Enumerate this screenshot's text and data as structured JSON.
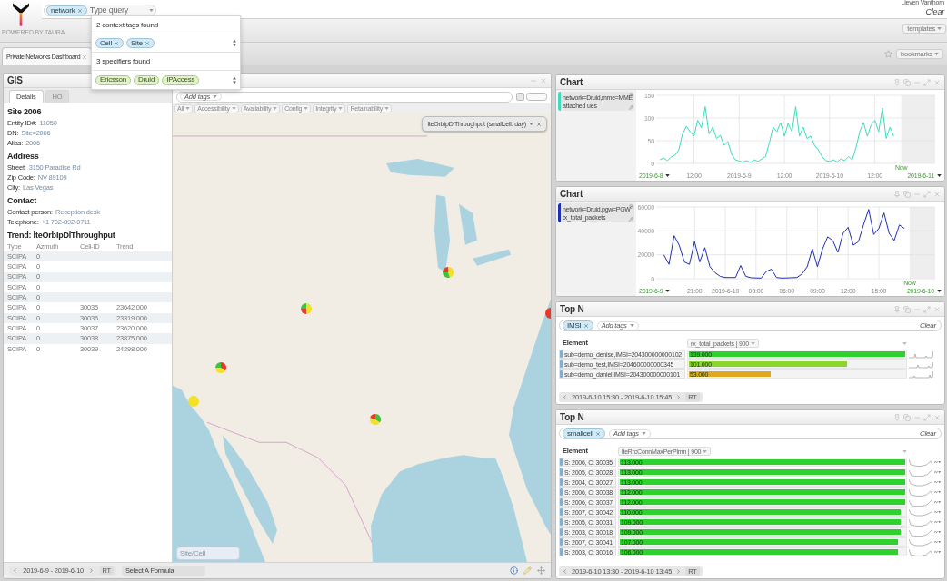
{
  "top_bar": {
    "logo_caption": "POWERED BY TAURA",
    "query_tags": [
      "network"
    ],
    "query_placeholder": "Type query",
    "user": "Lieven Vanthorn",
    "clear": "Clear",
    "templates": "templates"
  },
  "suggestions": [
    {
      "kind": "context",
      "title": "2 context tags found",
      "tags": [
        "Cell",
        "Site"
      ]
    },
    {
      "kind": "specifier",
      "title": "3 specifiers found",
      "tags": [
        "Ericsson",
        "Druid",
        "IPAccess"
      ]
    }
  ],
  "tabs": [
    {
      "label": "Private Networks Dashboard",
      "selected": true
    }
  ],
  "bookmarks": "bookmarks",
  "gis": {
    "title": "GIS",
    "detail_tabs": [
      {
        "label": "Details",
        "selected": true
      },
      {
        "label": "HO",
        "selected": false
      }
    ],
    "sections": [
      {
        "heading": "Site 2006",
        "fields": [
          {
            "label": "Entity ID#:",
            "value": "11050"
          },
          {
            "label": "DN:",
            "value": "Site=2006"
          },
          {
            "label": "Alias:",
            "value": "2006"
          }
        ]
      },
      {
        "heading": "Address",
        "fields": [
          {
            "label": "Street:",
            "value": "3150 Paradise Rd"
          },
          {
            "label": "Zip Code:",
            "value": "NV 89109"
          },
          {
            "label": "City:",
            "value": "Las Vegas"
          }
        ]
      },
      {
        "heading": "Contact",
        "fields": [
          {
            "label": "Contact person:",
            "value": "Reception desk"
          },
          {
            "label": "Telephone:",
            "value": "+1 702-892-0711"
          }
        ]
      }
    ],
    "trend": {
      "heading": "Trend: lteOrbIpDlThroughput",
      "columns": [
        "Type",
        "Azmuth",
        "Cell-ID",
        "Trend"
      ],
      "rows": [
        {
          "type": "SCIPA",
          "azimuth": "0"
        },
        {
          "type": "SCIPA",
          "azimuth": "0"
        },
        {
          "type": "SCIPA",
          "azimuth": "0"
        },
        {
          "type": "SCIPA",
          "azimuth": "0"
        },
        {
          "type": "SCIPA",
          "azimuth": "0"
        },
        {
          "type": "SCIPA",
          "azimuth": "0",
          "cell_id": "30035",
          "trend": "23642.000"
        },
        {
          "type": "SCIPA",
          "azimuth": "0",
          "cell_id": "30036",
          "trend": "23319.000"
        },
        {
          "type": "SCIPA",
          "azimuth": "0",
          "cell_id": "30037",
          "trend": "23620.000"
        },
        {
          "type": "SCIPA",
          "azimuth": "0",
          "cell_id": "30038",
          "trend": "23875.000"
        },
        {
          "type": "SCIPA",
          "azimuth": "0",
          "cell_id": "30039",
          "trend": "24298.000"
        }
      ]
    },
    "map": {
      "tag_placeholder": "Add tags",
      "categories": [
        "All",
        "Accessibility",
        "Availability",
        "Config",
        "Integrity",
        "Retainability"
      ],
      "layer": "lteOrbIpDlThroughput (smallcell: day)",
      "search_placeholder": "Site/Cell"
    },
    "footer": {
      "range": "2019-6-9 - 2019-6-10",
      "rt": "RT",
      "formula": "Select A Formula"
    }
  },
  "charts": [
    {
      "title": "Chart",
      "legend_scope": "network=Druid,mme=MME",
      "range_start": "2019-6-8",
      "range_end": "2019-6-11",
      "now_label": "Now",
      "chart_data": {
        "type": "line",
        "grid": true,
        "categories": [
          null,
          null,
          null,
          null,
          null,
          null,
          null,
          null,
          null,
          "12:00",
          null,
          null,
          null,
          null,
          null,
          null,
          null,
          null,
          null,
          null,
          null,
          "2019-6-9",
          null,
          null,
          null,
          null,
          null,
          null,
          null,
          null,
          null,
          null,
          null,
          "12:00",
          null,
          null,
          null,
          null,
          null,
          null,
          null,
          null,
          null,
          null,
          null,
          "2019-6-10",
          null,
          null,
          null,
          null,
          null,
          null,
          null,
          null,
          null,
          null,
          null,
          "12:00",
          null,
          null,
          null,
          null,
          null
        ],
        "series": [
          {
            "name": "attached ues",
            "color": "#3ddbc0",
            "values": [
              8,
              12,
              6,
              14,
              18,
              30,
              65,
              82,
              70,
              60,
              95,
              78,
              125,
              65,
              80,
              55,
              62,
              40,
              48,
              20,
              8,
              5,
              3,
              6,
              2,
              8,
              4,
              10,
              15,
              45,
              80,
              70,
              90,
              60,
              88,
              70,
              125,
              60,
              80,
              55,
              60,
              40,
              30,
              15,
              6,
              4,
              8,
              3,
              10,
              6,
              15,
              8,
              35,
              70,
              90,
              60,
              85,
              95,
              70,
              122,
              55,
              80,
              60
            ]
          }
        ],
        "ylim": [
          0,
          150
        ],
        "yticks": [
          0,
          50,
          100,
          150
        ]
      }
    },
    {
      "title": "Chart",
      "legend_scope": "network=Druid,pgw=PGW",
      "range_start": "2019-6-9",
      "range_end": "2019-6-10",
      "now_label": "Now",
      "chart_data": {
        "type": "line",
        "grid": true,
        "categories": [
          null,
          null,
          null,
          null,
          null,
          null,
          "21:00",
          null,
          null,
          null,
          null,
          null,
          "2019-6-10",
          null,
          null,
          null,
          null,
          null,
          "03:00",
          null,
          null,
          null,
          null,
          null,
          "06:00",
          null,
          null,
          null,
          null,
          null,
          "09:00",
          null,
          null,
          null,
          null,
          null,
          "12:00",
          null,
          null,
          null,
          null,
          null,
          "15:00",
          null,
          null,
          null,
          null,
          null
        ],
        "series": [
          {
            "name": "tx_total_packets",
            "color": "#1f2fb8",
            "values": [
              20000,
              12000,
              36000,
              28000,
              14000,
              12000,
              31000,
              14000,
              26000,
              10000,
              5000,
              2000,
              1000,
              1000,
              1000,
              11000,
              2000,
              800,
              600,
              500,
              6000,
              8000,
              1000,
              500,
              600,
              800,
              1000,
              4000,
              10000,
              25000,
              10000,
              25000,
              35000,
              32000,
              22000,
              38000,
              43000,
              28000,
              31000,
              45000,
              58000,
              37000,
              42000,
              55000,
              38000,
              32000,
              45000,
              42000
            ]
          }
        ],
        "ylim": [
          0,
          60000
        ],
        "yticks": [
          0,
          20000,
          40000,
          60000
        ]
      }
    }
  ],
  "top_n": [
    {
      "title": "Top N",
      "tags": [
        "IMSI"
      ],
      "add_placeholder": "Add tags",
      "clear": "Clear",
      "element_header": "Element",
      "metric": "rx_total_packets | 900",
      "trend_menu": false,
      "rows": [
        {
          "element": "sub=demo_denise,IMSI=204300000000102",
          "value": "139.000",
          "level": 1,
          "color": "#2ed12e"
        },
        {
          "element": "sub=demo_test,IMSI=204600000000345",
          "value": "101.000",
          "level": 0.73,
          "color": "#8bd62a"
        },
        {
          "element": "sub=demo_daniel,IMSI=204300000000101",
          "value": "53.000",
          "level": 0.38,
          "color": "#e0a820"
        }
      ],
      "range": "2019-6-10 15:30 - 2019-6-10 15:45",
      "rt": "RT"
    },
    {
      "title": "Top N",
      "tags": [
        "smallcell"
      ],
      "add_placeholder": "Add tags",
      "clear": "Clear",
      "element_header": "Element",
      "metric": "lteRrcConnMaxPerPlmn | 900",
      "trend_menu": true,
      "rows": [
        {
          "element": "S: 2006, C: 30035",
          "value": "113.000",
          "level": 1,
          "color": "#2ed12e"
        },
        {
          "element": "S: 2005, C: 30028",
          "value": "113.000",
          "level": 1,
          "color": "#2ed12e"
        },
        {
          "element": "S: 2004, C: 30027",
          "value": "113.000",
          "level": 1,
          "color": "#2ed12e"
        },
        {
          "element": "S: 2006, C: 30038",
          "value": "112.000",
          "level": 1,
          "color": "#2ed12e"
        },
        {
          "element": "S: 2006, C: 30037",
          "value": "112.000",
          "level": 1,
          "color": "#2ed12e"
        },
        {
          "element": "S: 2007, C: 30042",
          "value": "110.000",
          "level": 0.985,
          "color": "#2ed12e"
        },
        {
          "element": "S: 2005, C: 30031",
          "value": "109.000",
          "level": 0.985,
          "color": "#2ed12e"
        },
        {
          "element": "S: 2003, C: 30018",
          "value": "109.000",
          "level": 0.985,
          "color": "#2ed12e"
        },
        {
          "element": "S: 2007, C: 30041",
          "value": "107.000",
          "level": 0.975,
          "color": "#2ed12e"
        },
        {
          "element": "S: 2003, C: 30016",
          "value": "106.000",
          "level": 0.975,
          "color": "#2ed12e"
        }
      ],
      "range": "2019-6-10 13:30 - 2019-6-10 13:45",
      "rt": "RT"
    }
  ]
}
